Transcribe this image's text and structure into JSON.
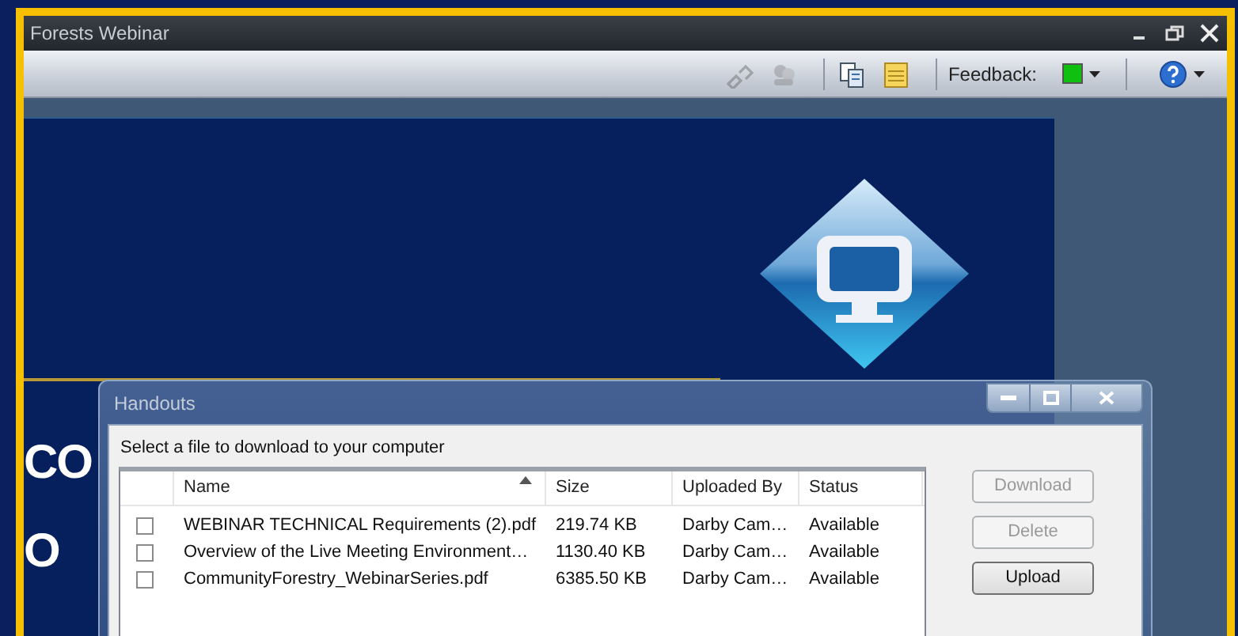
{
  "window": {
    "title": "Forests Webinar"
  },
  "toolbar": {
    "items": [
      {
        "kind": "link",
        "disabled": true
      },
      {
        "kind": "people",
        "disabled": true
      },
      {
        "kind": "copy",
        "disabled": false
      },
      {
        "kind": "notes",
        "disabled": false
      }
    ],
    "feedback": {
      "label": "Feedback:",
      "color": "#10c010"
    }
  },
  "slide": {
    "letters": [
      "CO",
      "O"
    ]
  },
  "dialog": {
    "title": "Handouts",
    "prompt": "Select a file to download to your computer",
    "columns": [
      {
        "label": "Name",
        "sorted": true
      },
      {
        "label": "Size",
        "sorted": false
      },
      {
        "label": "Uploaded By",
        "sorted": false
      },
      {
        "label": "Status",
        "sorted": false
      }
    ],
    "rows": [
      {
        "checked": false,
        "cells": [
          "WEBINAR TECHNICAL Requirements (2).pdf",
          "219.74 KB",
          "Darby Cam…",
          "Available"
        ]
      },
      {
        "checked": false,
        "cells": [
          "Overview of the Live Meeting Environment…",
          "1130.40 KB",
          "Darby Cam…",
          "Available"
        ]
      },
      {
        "checked": false,
        "cells": [
          "CommunityForestry_WebinarSeries.pdf",
          "6385.50 KB",
          "Darby Cam…",
          "Available"
        ]
      }
    ],
    "buttons": [
      {
        "label": "Download",
        "disabled": true
      },
      {
        "label": "Delete",
        "disabled": true
      },
      {
        "label": "Upload",
        "disabled": false
      }
    ]
  }
}
